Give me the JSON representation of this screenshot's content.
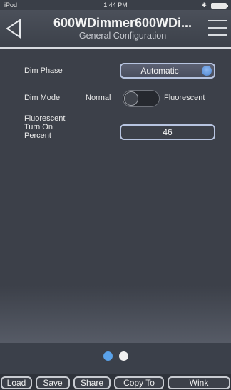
{
  "status": {
    "carrier": "iPod",
    "time": "1:44 PM"
  },
  "header": {
    "title": "600WDimmer600WDi...",
    "subtitle": "General Configuration"
  },
  "fields": {
    "dim_phase": {
      "label": "Dim Phase",
      "value": "Automatic"
    },
    "dim_mode": {
      "label": "Dim Mode",
      "left_label": "Normal",
      "right_label": "Fluorescent",
      "state": "Normal"
    },
    "fluorescent": {
      "label_line1": "Fluorescent",
      "label_line2": "Turn On",
      "label_line3": "Percent",
      "value": "46"
    }
  },
  "pager": {
    "count": 2,
    "active_index": 0
  },
  "toolbar": {
    "load": "Load",
    "save": "Save",
    "share": "Share",
    "copy_to": "Copy To",
    "wink": "Wink"
  },
  "colors": {
    "accent": "#5aa2ea",
    "background": "#3c4049"
  }
}
